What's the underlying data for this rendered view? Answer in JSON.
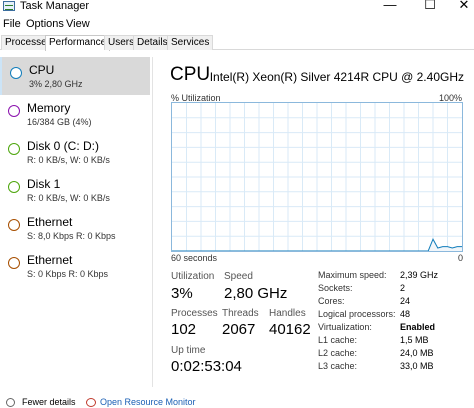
{
  "window": {
    "title": "Task Manager",
    "controls": {
      "minimize": "—",
      "maximize": "☐",
      "close": "✕"
    }
  },
  "menu": [
    "File",
    "Options",
    "View"
  ],
  "tabs": [
    {
      "label": "Processes"
    },
    {
      "label": "Performance",
      "active": true
    },
    {
      "label": "Users"
    },
    {
      "label": "Details"
    },
    {
      "label": "Services"
    }
  ],
  "sidebar": {
    "items": [
      {
        "title": "CPU",
        "sub": "3%  2,80 GHz",
        "color": "#117dbb",
        "active": true
      },
      {
        "title": "Memory",
        "sub": "16/384 GB (4%)",
        "color": "#8b12ae"
      },
      {
        "title": "Disk 0 (C: D:)",
        "sub": "R: 0 KB/s, W: 0 KB/s",
        "color": "#4da60c"
      },
      {
        "title": "Disk 1",
        "sub": "R: 0 KB/s, W: 0 KB/s",
        "color": "#4da60c"
      },
      {
        "title": "Ethernet",
        "sub": "S: 8,0 Kbps  R: 0 Kbps",
        "color": "#a74f01"
      },
      {
        "title": "Ethernet",
        "sub": "S: 0 Kbps  R: 0 Kbps",
        "color": "#a74f01"
      }
    ]
  },
  "main": {
    "title": "CPU",
    "cpu_name": "Intel(R) Xeon(R) Silver 4214R CPU @ 2.40GHz",
    "util_label": "% Utilization",
    "util_max": "100%",
    "graph_left": "60 seconds",
    "graph_right": "0",
    "graph_color": "#117dbb",
    "utilization_history": [
      0,
      0,
      0,
      0,
      0,
      0,
      0,
      0,
      0,
      0,
      0,
      0,
      0,
      0,
      0,
      0,
      0,
      0,
      0,
      0,
      0,
      0,
      0,
      0,
      0,
      0,
      0,
      0,
      0,
      0,
      0,
      0,
      0,
      0,
      0,
      0,
      0,
      0,
      0,
      0,
      0,
      0,
      0,
      0,
      0,
      0,
      0,
      0,
      0,
      0,
      0,
      0,
      0,
      0,
      8,
      2,
      3,
      3,
      2,
      3,
      3
    ]
  },
  "stats": {
    "utilization": {
      "label": "Utilization",
      "value": "3%"
    },
    "speed": {
      "label": "Speed",
      "value": "2,80 GHz"
    },
    "processes": {
      "label": "Processes",
      "value": "102"
    },
    "threads": {
      "label": "Threads",
      "value": "2067"
    },
    "handles": {
      "label": "Handles",
      "value": "40162"
    },
    "uptime": {
      "label": "Up time",
      "value": "0:02:53:04"
    }
  },
  "specs": [
    {
      "label": "Maximum speed:",
      "value": "2,39 GHz"
    },
    {
      "label": "Sockets:",
      "value": "2"
    },
    {
      "label": "Cores:",
      "value": "24"
    },
    {
      "label": "Logical processors:",
      "value": "48"
    },
    {
      "label": "Virtualization:",
      "value": "Enabled",
      "bold": true
    },
    {
      "label": "L1 cache:",
      "value": "1,5 MB"
    },
    {
      "label": "L2 cache:",
      "value": "24,0 MB"
    },
    {
      "label": "L3 cache:",
      "value": "33,0 MB"
    }
  ],
  "footer": {
    "fewer_details": "Fewer details",
    "resource_monitor": "Open Resource Monitor"
  }
}
